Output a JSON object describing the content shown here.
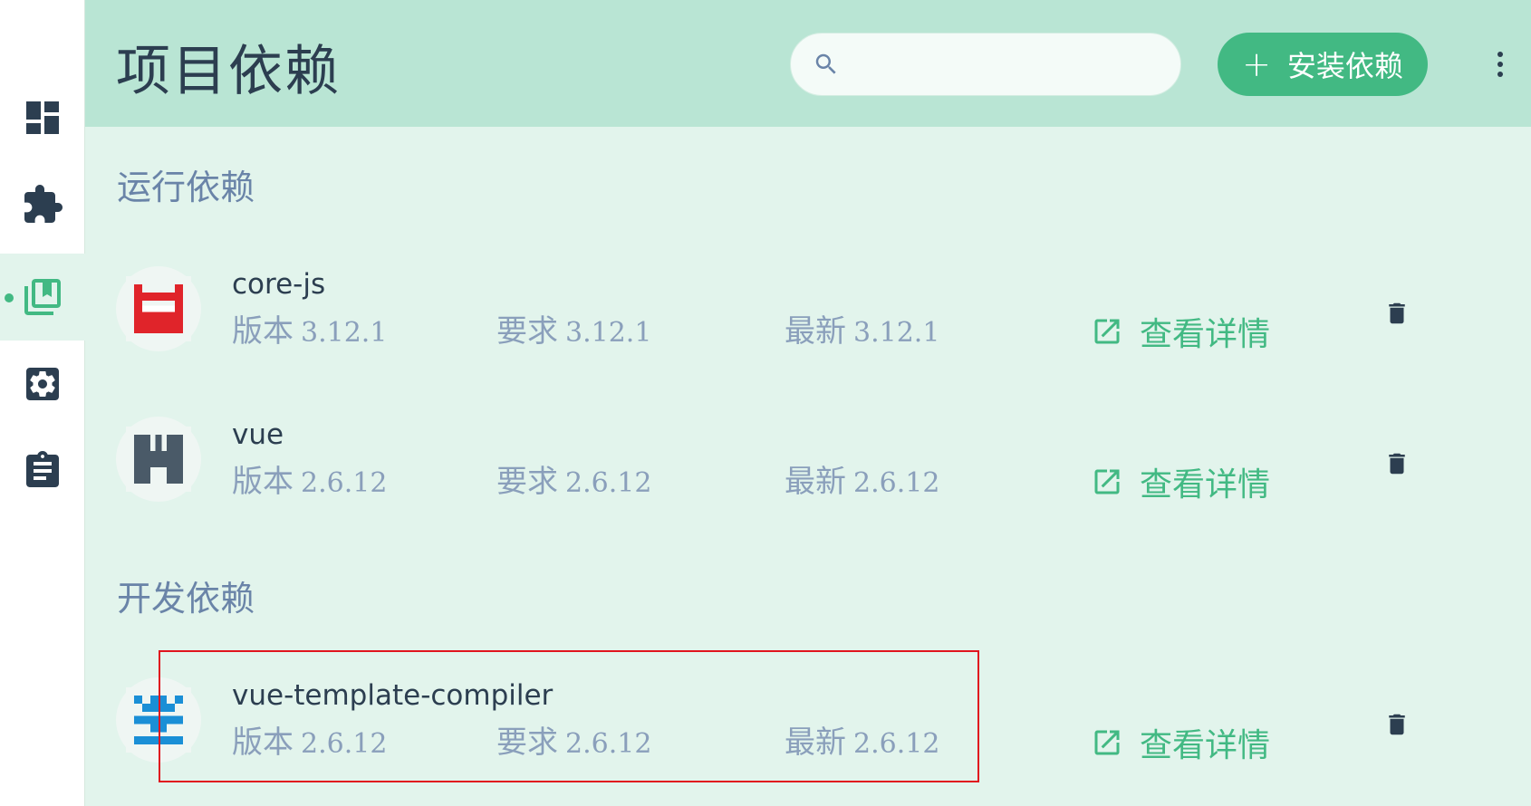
{
  "sidebar": {
    "items": [
      {
        "name": "dashboard-icon"
      },
      {
        "name": "plugins-icon"
      },
      {
        "name": "dependencies-icon",
        "active": true
      },
      {
        "name": "configuration-icon"
      },
      {
        "name": "tasks-icon"
      }
    ]
  },
  "header": {
    "title": "项目依赖",
    "search": {
      "placeholder": "",
      "value": ""
    },
    "install_label": "安装依赖",
    "install_icon": "+"
  },
  "sections": [
    {
      "title": "运行依赖",
      "dependencies": [
        {
          "name": "core-js",
          "version_label": "版本",
          "version": "3.12.1",
          "wanted_label": "要求",
          "wanted": "3.12.1",
          "latest_label": "最新",
          "latest": "3.12.1",
          "details_label": "查看详情",
          "icon_color": "#e0242a"
        },
        {
          "name": "vue",
          "version_label": "版本",
          "version": "2.6.12",
          "wanted_label": "要求",
          "wanted": "2.6.12",
          "latest_label": "最新",
          "latest": "2.6.12",
          "details_label": "查看详情",
          "icon_color": "#4a5a68"
        }
      ]
    },
    {
      "title": "开发依赖",
      "dependencies": [
        {
          "name": "vue-template-compiler",
          "version_label": "版本",
          "version": "2.6.12",
          "wanted_label": "要求",
          "wanted": "2.6.12",
          "latest_label": "最新",
          "latest": "2.6.12",
          "details_label": "查看详情",
          "icon_color": "#1a8fd6"
        }
      ]
    }
  ],
  "colors": {
    "accent": "#42b983",
    "header_bg": "#b9e5d4",
    "content_bg": "#e2f4ec",
    "highlight": "#e0141e"
  }
}
